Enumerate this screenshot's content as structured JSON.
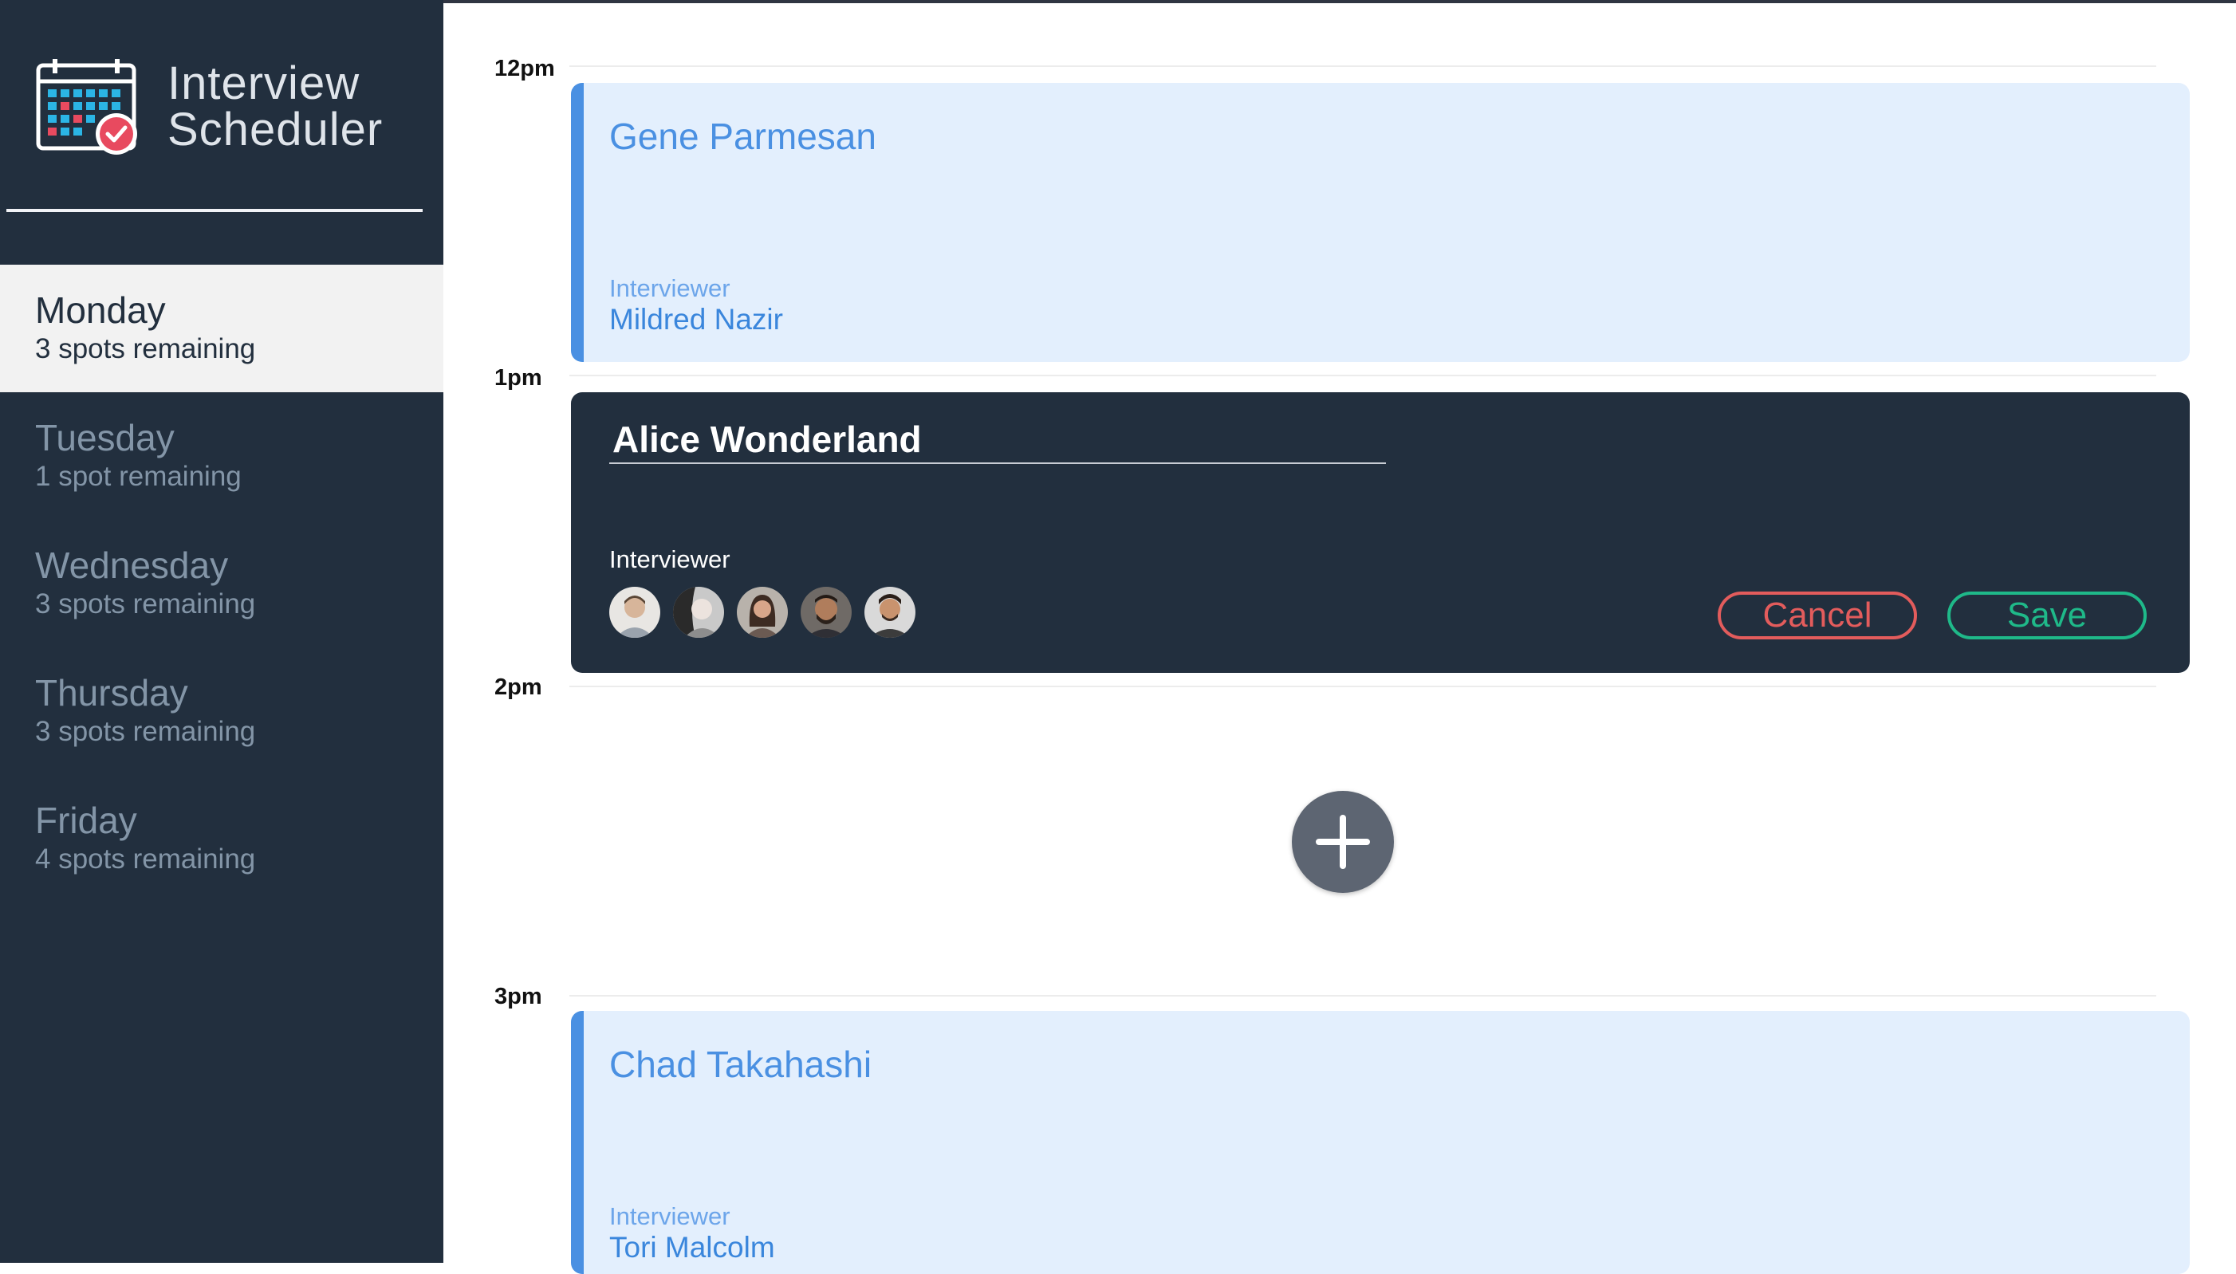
{
  "app": {
    "title_line1": "Interview",
    "title_line2": "Scheduler"
  },
  "sidebar": {
    "days": [
      {
        "name": "Monday",
        "spots": "3 spots remaining",
        "selected": true
      },
      {
        "name": "Tuesday",
        "spots": "1 spot remaining",
        "selected": false
      },
      {
        "name": "Wednesday",
        "spots": "3 spots remaining",
        "selected": false
      },
      {
        "name": "Thursday",
        "spots": "3 spots remaining",
        "selected": false
      },
      {
        "name": "Friday",
        "spots": "4 spots remaining",
        "selected": false
      }
    ]
  },
  "schedule": {
    "times": [
      "12pm",
      "1pm",
      "2pm",
      "3pm"
    ],
    "appointments": [
      {
        "student": "Gene Parmesan",
        "interviewer_label": "Interviewer",
        "interviewer": "Mildred Nazir"
      },
      {
        "student": "Chad Takahashi",
        "interviewer_label": "Interviewer",
        "interviewer": "Tori Malcolm"
      }
    ],
    "form": {
      "name_value": "Alice Wonderland",
      "interviewer_label": "Interviewer",
      "avatar_count": 5,
      "cancel_label": "Cancel",
      "save_label": "Save"
    }
  },
  "colors": {
    "sidebar_bg": "#222f3e",
    "accent_blue": "#4a90e2",
    "appointment_bg": "#e3effd",
    "cancel_red": "#e35c5c",
    "save_green": "#1fb989"
  },
  "icons": [
    "calendar-check-icon",
    "plus-icon"
  ]
}
